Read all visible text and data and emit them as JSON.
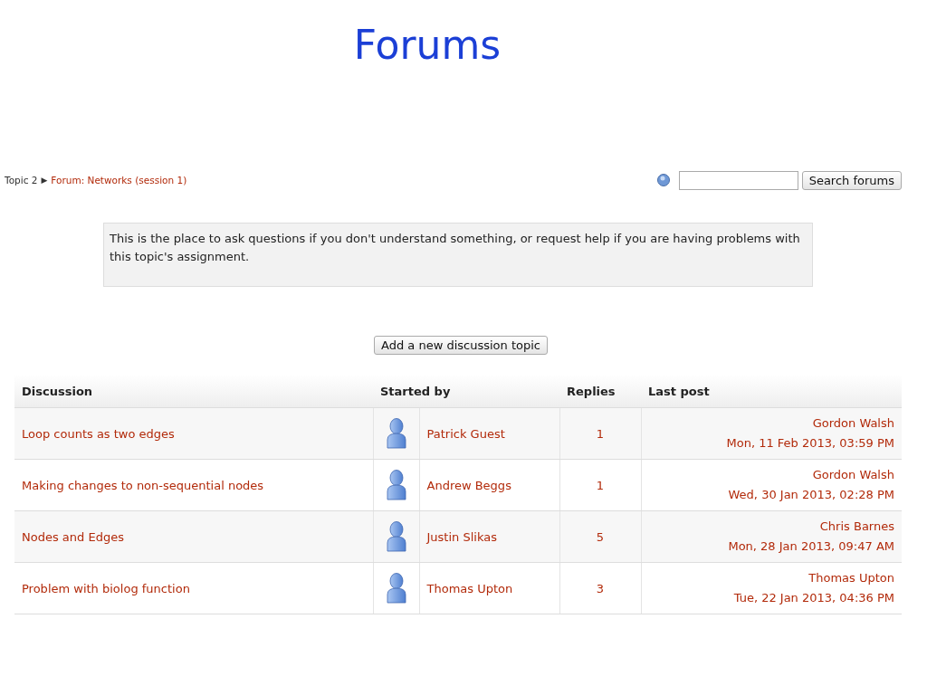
{
  "slide_title": "Forums",
  "breadcrumb": {
    "parent": "Topic 2",
    "separator": "▶",
    "current": "Forum: Networks (session 1)"
  },
  "search": {
    "button": "Search forums"
  },
  "intro": "This is the place to ask questions if you don't understand something, or request help if you are having problems with this topic's assignment.",
  "add_button": "Add a new discussion topic",
  "table": {
    "columns": [
      "Discussion",
      "Started by",
      "Replies",
      "Last post"
    ],
    "rows": [
      {
        "discussion": "Loop counts as two edges",
        "started_by": "Patrick Guest",
        "replies": "1",
        "last_post_author": "Gordon Walsh",
        "last_post_date": "Mon, 11 Feb 2013, 03:59 PM"
      },
      {
        "discussion": "Making changes to non-sequential nodes",
        "started_by": "Andrew Beggs",
        "replies": "1",
        "last_post_author": "Gordon Walsh",
        "last_post_date": "Wed, 30 Jan 2013, 02:28 PM"
      },
      {
        "discussion": "Nodes and Edges",
        "started_by": "Justin Slikas",
        "replies": "5",
        "last_post_author": "Chris Barnes",
        "last_post_date": "Mon, 28 Jan 2013, 09:47 AM"
      },
      {
        "discussion": "Problem with biolog function",
        "started_by": "Thomas Upton",
        "replies": "3",
        "last_post_author": "Thomas Upton",
        "last_post_date": "Tue, 22 Jan 2013, 04:36 PM"
      }
    ]
  }
}
